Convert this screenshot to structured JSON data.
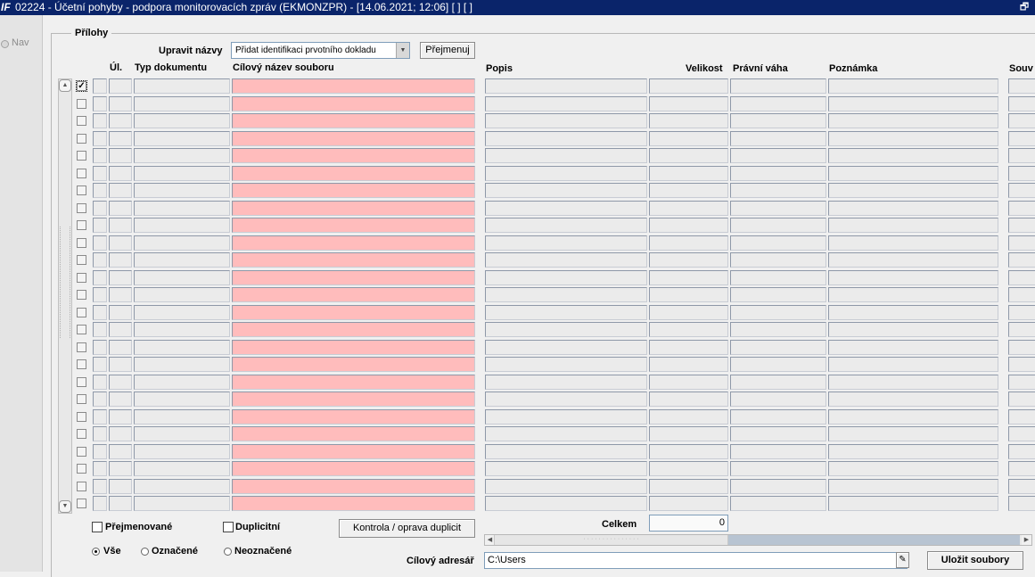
{
  "window": {
    "title": "02224 - Účetní pohyby - podpora monitorovacích zpráv (EKMONZPR) - [14.06.2021; 12:06]  [ ]  [ ]",
    "icon_text": "IF",
    "restore_glyph": "🗗"
  },
  "sidebar": {
    "nav_label": "Nav"
  },
  "attachments": {
    "section_title": "Přílohy",
    "rename_label": "Upravit názvy",
    "rename_select_value": "Přidat identifikaci prvotního dokladu",
    "rename_button": "Přejmenuj",
    "columns": [
      "Úl.",
      "Typ dokumentu",
      "Cílový název souboru",
      "Popis",
      "Velikost",
      "Právní váha",
      "Poznámka",
      "Souv"
    ],
    "row_count": 25,
    "first_row_checked": true,
    "check_glyph": "✓",
    "renamed_label": "Přejmenované",
    "duplicates_label": "Duplicitní",
    "fix_duplicates_button": "Kontrola / oprava duplicit",
    "filter_options": [
      {
        "label": "Vše",
        "selected": true
      },
      {
        "label": "Označené",
        "selected": false
      },
      {
        "label": "Neoznačené",
        "selected": false
      }
    ],
    "total_label": "Celkem",
    "total_value": "0",
    "target_dir_label": "Cílový adresář",
    "target_dir_value": "C:\\Users",
    "save_button": "Uložit soubory"
  },
  "colors": {
    "titlebar": "#0a246a",
    "required_field": "#ffbcbc",
    "field": "#ebebeb"
  }
}
